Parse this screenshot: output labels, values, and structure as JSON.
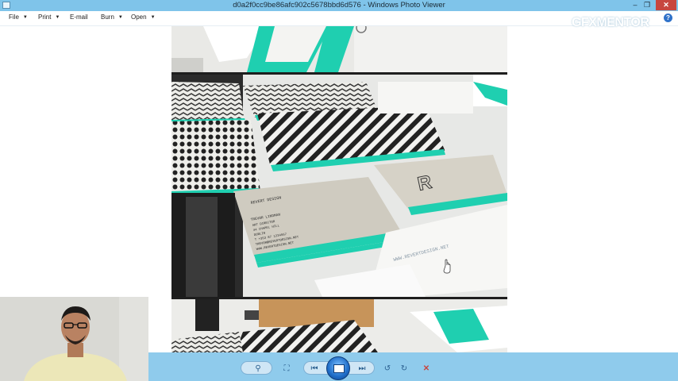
{
  "window": {
    "title": "d0a2f0cc9be86afc902c5678bbd6d576 - Windows Photo Viewer",
    "minimize_glyph": "–",
    "restore_glyph": "❐",
    "close_glyph": "✕"
  },
  "menu": {
    "file": "File",
    "print": "Print",
    "email": "E-mail",
    "burn": "Burn",
    "open": "Open",
    "help_glyph": "?"
  },
  "watermark": {
    "part1": "GFX",
    "part2": "MENTOR"
  },
  "photo": {
    "card_brand": "REVERT DESIGN",
    "card_name": "TREVOR LINDMAN",
    "card_lines": [
      "ART DIRECTOR",
      "44 CHAPEL HILL",
      "DUBLIN",
      "T +353 87 1234567",
      "TREVOR@REVERTDESIGN.NET",
      "WWW.REVERTDESIGN.NET"
    ],
    "card_logo": "R",
    "envelope_url": "WWW.REVERTDESIGN.NET"
  },
  "controls": {
    "zoom_glyph": "⚲",
    "fit_glyph": "⛶",
    "prev_glyph": "⏮",
    "next_glyph": "⏭",
    "rotate_ccw_glyph": "↺",
    "rotate_cw_glyph": "↻",
    "delete_glyph": "✕"
  },
  "colors": {
    "titlebar": "#7fc4ea",
    "bottombar": "#8fcbec",
    "teal_accent": "#1fcfb0",
    "close_red": "#c7463f"
  }
}
